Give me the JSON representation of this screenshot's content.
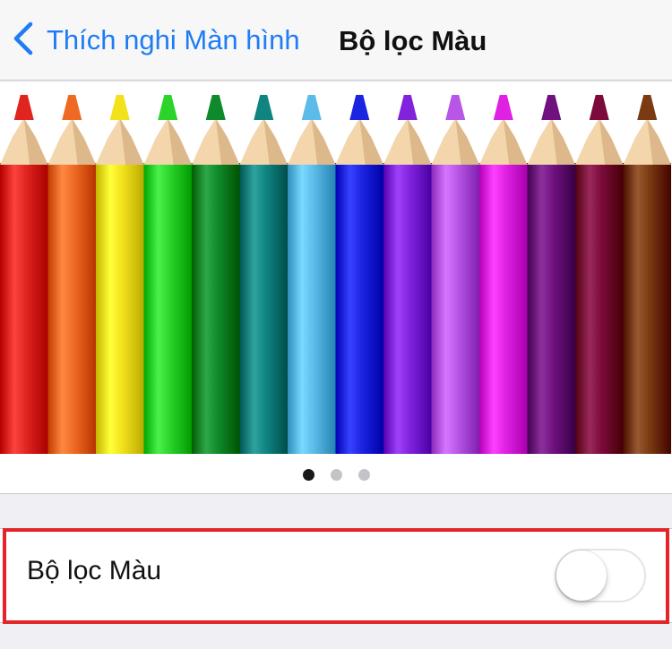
{
  "nav": {
    "back_label": "Thích nghi Màn hình",
    "title": "Bộ lọc Màu"
  },
  "preview": {
    "pencil_colors": [
      "#e0241f",
      "#ee6a23",
      "#f2e21c",
      "#2bd32b",
      "#0f8a2b",
      "#0f8481",
      "#5cbbe8",
      "#1b24e0",
      "#8123dd",
      "#b857e7",
      "#e021e4",
      "#6f117f",
      "#7c0b3c",
      "#7a3b12"
    ],
    "page_count": 3,
    "active_page": 0
  },
  "setting": {
    "label": "Bộ lọc Màu",
    "enabled": false
  },
  "colors": {
    "accent": "#1f7cf5",
    "highlight": "#e3242b"
  }
}
